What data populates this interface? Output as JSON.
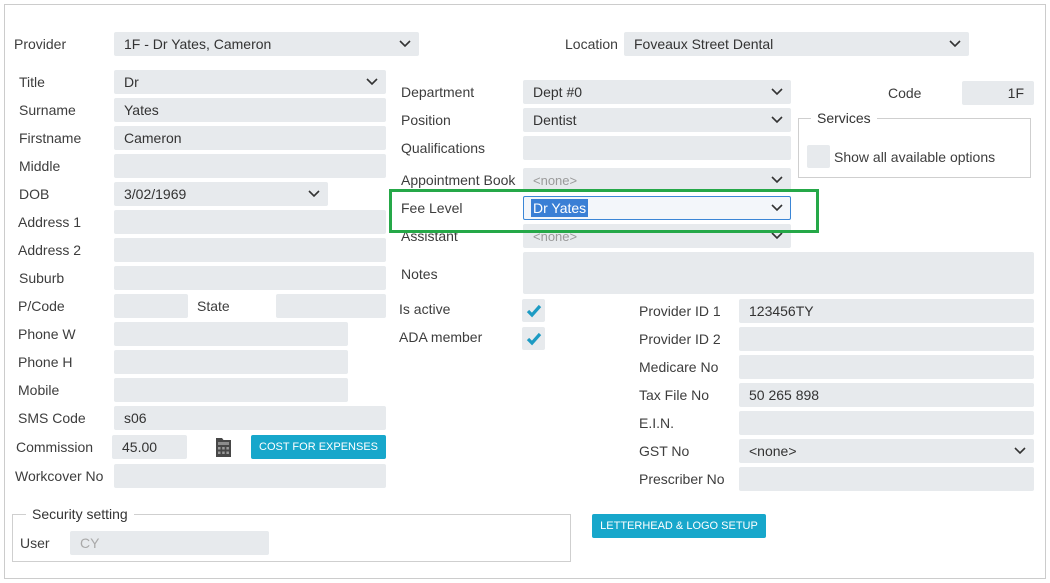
{
  "header": {
    "provider": {
      "label": "Provider",
      "value": "1F - Dr Yates, Cameron"
    },
    "location": {
      "label": "Location",
      "value": "Foveaux Street Dental"
    }
  },
  "personal": {
    "title": {
      "label": "Title",
      "value": "Dr"
    },
    "surname": {
      "label": "Surname",
      "value": "Yates"
    },
    "firstname": {
      "label": "Firstname",
      "value": "Cameron"
    },
    "middle": {
      "label": "Middle",
      "value": ""
    },
    "dob": {
      "label": "DOB",
      "value": "3/02/1969"
    },
    "address1": {
      "label": "Address 1",
      "value": ""
    },
    "address2": {
      "label": "Address 2",
      "value": ""
    },
    "suburb": {
      "label": "Suburb",
      "value": ""
    },
    "pcode": {
      "label": "P/Code",
      "value": ""
    },
    "state": {
      "label": "State",
      "value": ""
    },
    "phone_w": {
      "label": "Phone W",
      "value": ""
    },
    "phone_h": {
      "label": "Phone H",
      "value": ""
    },
    "mobile": {
      "label": "Mobile",
      "value": ""
    },
    "sms_code": {
      "label": "SMS Code",
      "value": "s06"
    },
    "commission": {
      "label": "Commission",
      "value": "45.00"
    },
    "workcover": {
      "label": "Workcover No",
      "value": ""
    }
  },
  "security": {
    "legend": "Security setting",
    "user": {
      "label": "User",
      "value": "CY"
    }
  },
  "practice": {
    "department": {
      "label": "Department",
      "value": "Dept #0"
    },
    "position": {
      "label": "Position",
      "value": "Dentist"
    },
    "qualifications": {
      "label": "Qualifications",
      "value": ""
    },
    "appointment_book": {
      "label": "Appointment Book",
      "value": "<none>"
    },
    "fee_level": {
      "label": "Fee Level",
      "value": "Dr Yates"
    },
    "assistant": {
      "label": "Assistant",
      "value": "<none>"
    },
    "notes": {
      "label": "Notes",
      "value": ""
    }
  },
  "flags": {
    "is_active": {
      "label": "Is active",
      "checked": true
    },
    "ada_member": {
      "label": "ADA member",
      "checked": true
    }
  },
  "code": {
    "label": "Code",
    "value": "1F"
  },
  "services": {
    "legend": "Services",
    "show_all": {
      "label": "Show all available options",
      "checked": false
    }
  },
  "identifiers": {
    "provider_id_1": {
      "label": "Provider ID 1",
      "value": "123456TY"
    },
    "provider_id_2": {
      "label": "Provider ID 2",
      "value": ""
    },
    "medicare_no": {
      "label": "Medicare No",
      "value": ""
    },
    "tax_file_no": {
      "label": "Tax File No",
      "value": "50 265 898"
    },
    "ein": {
      "label": "E.I.N.",
      "value": ""
    },
    "gst_no": {
      "label": "GST No",
      "value": "<none>"
    },
    "prescriber_no": {
      "label": "Prescriber No",
      "value": ""
    }
  },
  "buttons": {
    "cost_for_expenses": "COST FOR EXPENSES",
    "letterhead_logo_setup": "LETTERHEAD & LOGO SETUP"
  },
  "icons": {
    "dropdown": "chevron-down-icon",
    "checkbox_check": "checkmark-icon",
    "commission_tool": "calculator-icon"
  },
  "colors": {
    "accent": "#17a7cb",
    "check": "#1d9bc3",
    "field_background": "#e7eaed",
    "highlight_box": "#25a848",
    "selection": "#3a7fd5"
  }
}
